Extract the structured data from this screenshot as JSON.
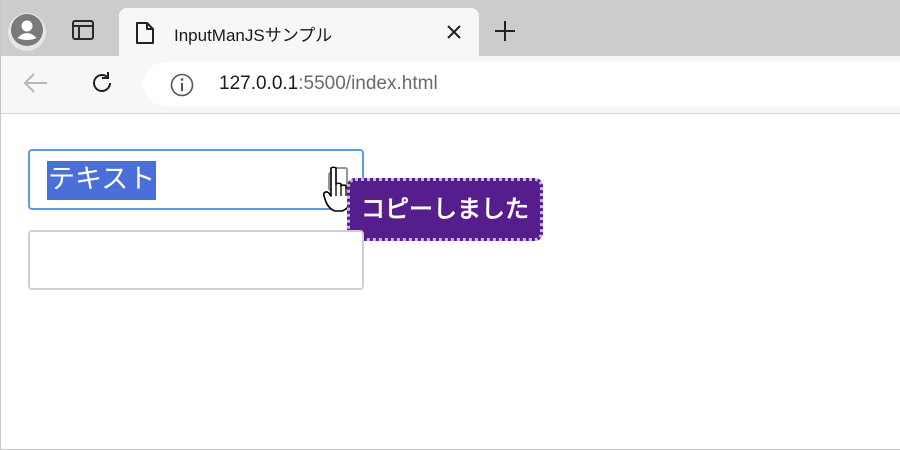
{
  "browser": {
    "tab": {
      "title": "InputManJSサンプル"
    },
    "address_bar": {
      "host": "127.0.0.1",
      "rest": ":5500/index.html"
    }
  },
  "page": {
    "text_input": {
      "value": "テキスト"
    },
    "copy_tooltip": {
      "text": "コピーしました"
    }
  },
  "colors": {
    "selection": "#4a6fd8",
    "focus_border": "#5b9be8",
    "tooltip_bg": "#561d8c"
  },
  "icons": [
    "profile-icon",
    "vertical-tabs-icon",
    "file-icon",
    "close-icon",
    "plus-icon",
    "back-arrow-icon",
    "reload-icon",
    "info-icon",
    "copy-icon",
    "hand-pointer-cursor"
  ]
}
